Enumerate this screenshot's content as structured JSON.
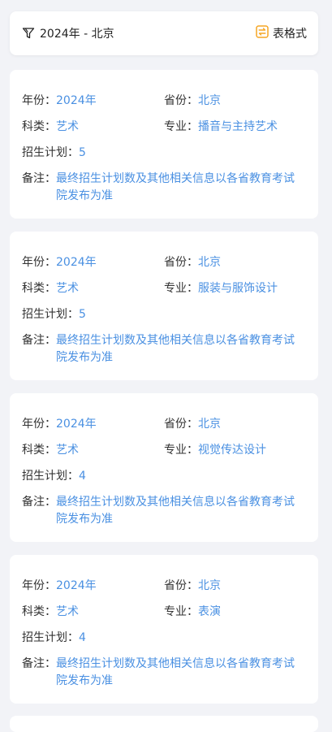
{
  "filter": {
    "label": "2024年 - 北京",
    "icon": "funnel-icon",
    "toggle_label": "表格式",
    "toggle_icon": "swap-icon",
    "accent_color": "#f5a623"
  },
  "labels": {
    "year": "年份：",
    "province": "省份：",
    "category": "科类：",
    "major": "专业：",
    "plan": "招生计划：",
    "note": "备注："
  },
  "value_color": "#4a90e2",
  "records": [
    {
      "year": "2024年",
      "province": "北京",
      "category": "艺术",
      "major": "播音与主持艺术",
      "plan": "5",
      "note": "最终招生计划数及其他相关信息以各省教育考试院发布为准"
    },
    {
      "year": "2024年",
      "province": "北京",
      "category": "艺术",
      "major": "服装与服饰设计",
      "plan": "5",
      "note": "最终招生计划数及其他相关信息以各省教育考试院发布为准"
    },
    {
      "year": "2024年",
      "province": "北京",
      "category": "艺术",
      "major": "视觉传达设计",
      "plan": "4",
      "note": "最终招生计划数及其他相关信息以各省教育考试院发布为准"
    },
    {
      "year": "2024年",
      "province": "北京",
      "category": "艺术",
      "major": "表演",
      "plan": "4",
      "note": "最终招生计划数及其他相关信息以各省教育考试院发布为准"
    }
  ]
}
